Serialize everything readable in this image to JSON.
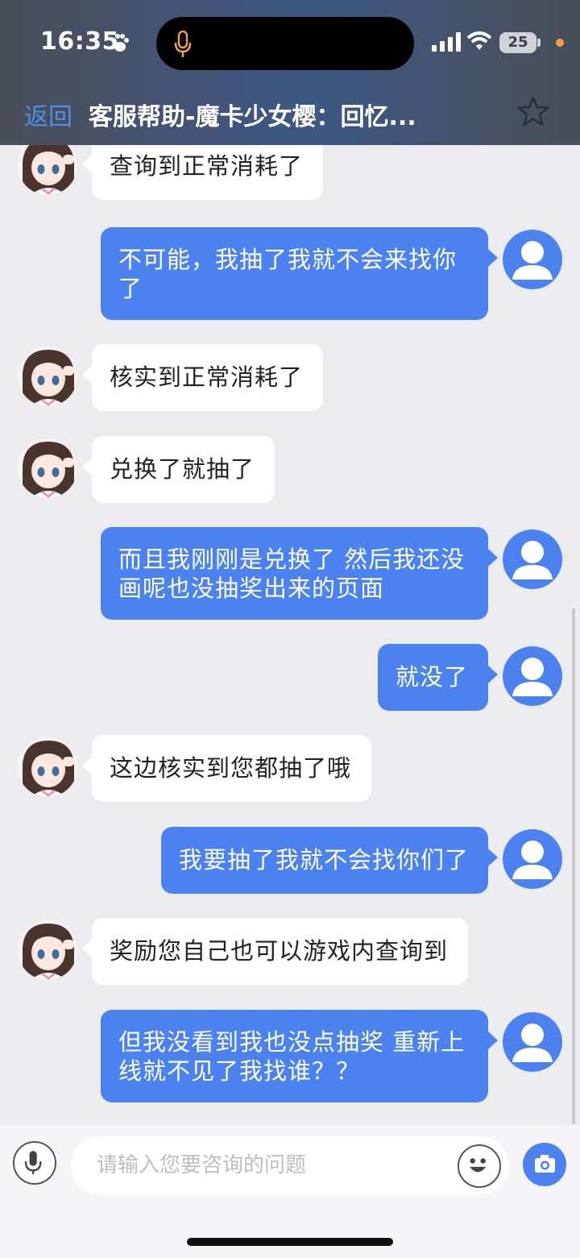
{
  "status_bar": {
    "time": "16:35",
    "battery": "25"
  },
  "nav": {
    "back": "返回",
    "title": "客服帮助-魔卡少女樱：回忆..."
  },
  "messages": [
    {
      "role": "agent",
      "text": "查询到正常消耗了"
    },
    {
      "role": "user",
      "text": "不可能，我抽了我就不会来找你\n了"
    },
    {
      "role": "agent",
      "text": "核实到正常消耗了"
    },
    {
      "role": "agent",
      "text": "兑换了就抽了"
    },
    {
      "role": "user",
      "text": "而且我刚刚是兑换了 然后我还没\n画呢也没抽奖出来的页面"
    },
    {
      "role": "user",
      "text": "就没了"
    },
    {
      "role": "agent",
      "text": "这边核实到您都抽了哦"
    },
    {
      "role": "user",
      "text": "我要抽了我就不会找你们了"
    },
    {
      "role": "agent",
      "text": "奖励您自己也可以游戏内查询到"
    },
    {
      "role": "user",
      "text": "但我没看到我也没点抽奖 重新上\n线就不见了我找谁？？"
    }
  ],
  "input": {
    "placeholder": "请输入您要咨询的问题"
  },
  "colors": {
    "user_bubble": "#4b82f0",
    "agent_bubble": "#ffffff",
    "back_link": "#4b8fe8"
  }
}
